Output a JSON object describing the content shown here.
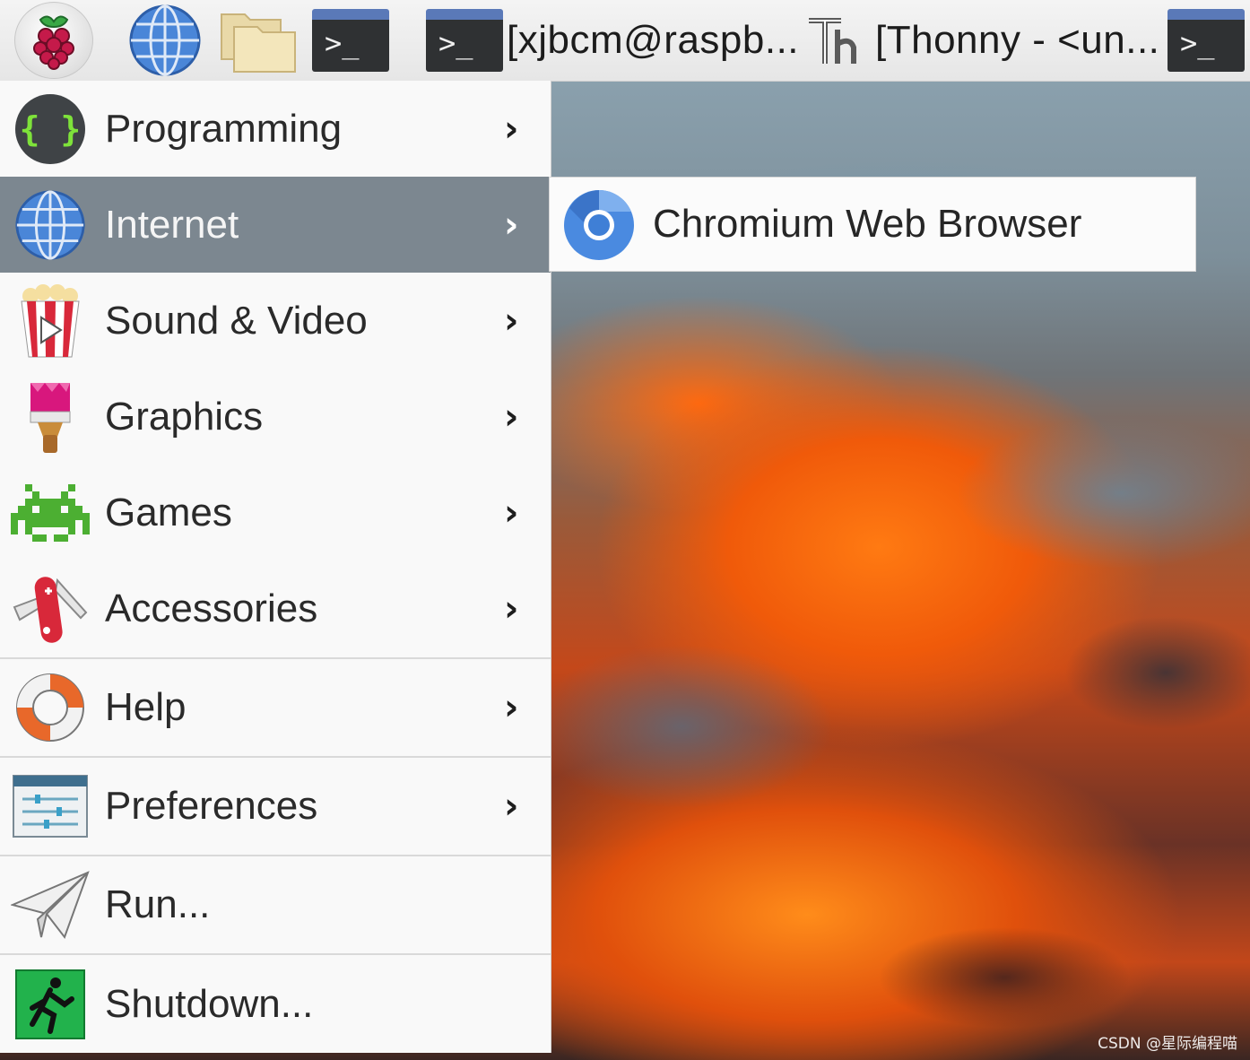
{
  "taskbar": {
    "menu_button_icon": "raspberry-pi-logo",
    "launchers": [
      {
        "icon": "globe-web-browser"
      },
      {
        "icon": "file-manager-folder"
      },
      {
        "icon": "terminal"
      }
    ],
    "tasks": [
      {
        "label": "[xjbcm@raspb...",
        "icon": "terminal"
      },
      {
        "label": "[Thonny  -  <un...",
        "icon": "thonny-th"
      },
      {
        "label": "",
        "icon": "terminal"
      }
    ],
    "terminal_glyph": ">_"
  },
  "menu": {
    "items": [
      {
        "label": "Programming",
        "icon": "code-braces",
        "submenu": true
      },
      {
        "label": "Internet",
        "icon": "globe",
        "submenu": true,
        "active": true
      },
      {
        "label": "Sound & Video",
        "icon": "popcorn-play",
        "submenu": true
      },
      {
        "label": "Graphics",
        "icon": "paint-brush",
        "submenu": true
      },
      {
        "label": "Games",
        "icon": "space-invader",
        "submenu": true
      },
      {
        "label": "Accessories",
        "icon": "swiss-army-knife",
        "submenu": true
      },
      {
        "label": "Help",
        "icon": "lifebuoy",
        "submenu": true
      },
      {
        "label": "Preferences",
        "icon": "settings-sliders",
        "submenu": true
      },
      {
        "label": "Run...",
        "icon": "paper-plane",
        "submenu": false
      },
      {
        "label": "Shutdown...",
        "icon": "exit-running-man",
        "submenu": false
      }
    ],
    "chevron": "›"
  },
  "submenu": {
    "items": [
      {
        "label": "Chromium Web Browser",
        "icon": "chromium"
      }
    ]
  },
  "watermark": "CSDN @星际编程喵",
  "colors": {
    "active_row": "#7c8790",
    "menu_bg": "#f9f9f9",
    "terminal_header": "#5a79b8"
  }
}
